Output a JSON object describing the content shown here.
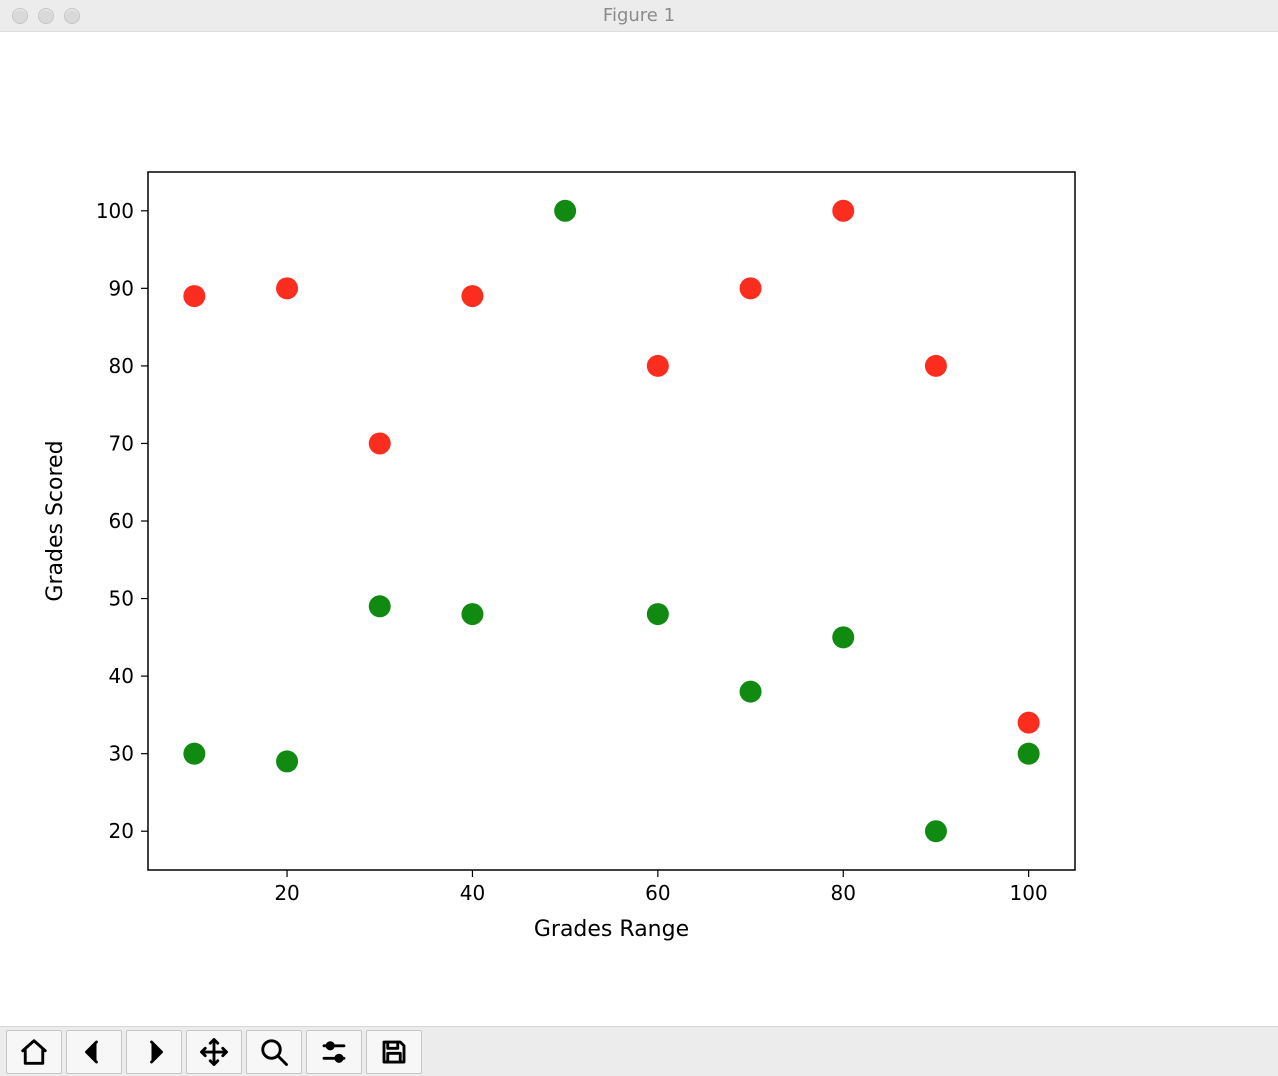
{
  "window": {
    "title": "Figure 1"
  },
  "chart_data": {
    "type": "scatter",
    "xlabel": "Grades Range",
    "ylabel": "Grades Scored",
    "xlim": [
      5,
      105
    ],
    "ylim": [
      15,
      105
    ],
    "xticks": [
      20,
      40,
      60,
      80,
      100
    ],
    "yticks": [
      20,
      30,
      40,
      50,
      60,
      70,
      80,
      90,
      100
    ],
    "series": [
      {
        "name": "red",
        "color": "#fb2d1e",
        "points": [
          {
            "x": 10,
            "y": 89
          },
          {
            "x": 20,
            "y": 90
          },
          {
            "x": 30,
            "y": 70
          },
          {
            "x": 40,
            "y": 89
          },
          {
            "x": 60,
            "y": 80
          },
          {
            "x": 70,
            "y": 90
          },
          {
            "x": 80,
            "y": 100
          },
          {
            "x": 90,
            "y": 80
          },
          {
            "x": 100,
            "y": 34
          }
        ]
      },
      {
        "name": "green",
        "color": "#108a10",
        "points": [
          {
            "x": 10,
            "y": 30
          },
          {
            "x": 20,
            "y": 29
          },
          {
            "x": 30,
            "y": 49
          },
          {
            "x": 40,
            "y": 48
          },
          {
            "x": 50,
            "y": 100
          },
          {
            "x": 60,
            "y": 48
          },
          {
            "x": 70,
            "y": 38
          },
          {
            "x": 80,
            "y": 45
          },
          {
            "x": 90,
            "y": 20
          },
          {
            "x": 100,
            "y": 30
          }
        ]
      }
    ]
  },
  "toolbar": {
    "home": "Home",
    "back": "Back",
    "forward": "Forward",
    "pan": "Pan",
    "zoom": "Zoom",
    "configure": "Configure",
    "save": "Save"
  }
}
